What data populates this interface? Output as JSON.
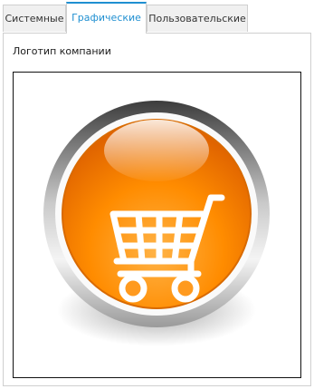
{
  "tabs": [
    {
      "label": "Системные",
      "active": false
    },
    {
      "label": "Графические",
      "active": true
    },
    {
      "label": "Пользовательские",
      "active": false
    }
  ],
  "logo_section": {
    "label": "Логотип компании",
    "image": "shopping-cart-orange-button"
  },
  "colors": {
    "accent": "#1f8fd1",
    "logo_orange": "#ff8c00",
    "border": "#cfcfcf"
  }
}
